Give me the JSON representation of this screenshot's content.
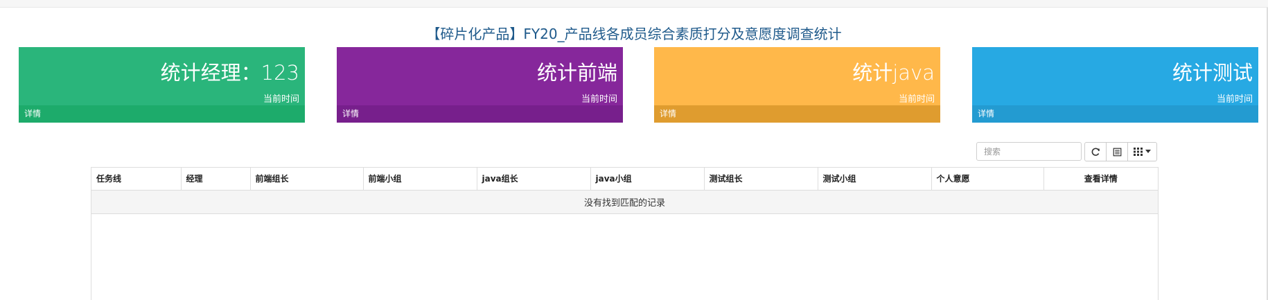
{
  "page": {
    "title": "【碎片化产品】FY20_产品线各成员综合素质打分及意愿度调查统计"
  },
  "cards": [
    {
      "value": "统计经理：123",
      "time": "当前时间",
      "footer": "详情",
      "color": "#2ab57b",
      "footer_color": "#1dab6b"
    },
    {
      "value": "统计前端",
      "time": "当前时间",
      "footer": "详情",
      "color": "#86279b",
      "footer_color": "#771f8c"
    },
    {
      "value": "统计java",
      "time": "当前时间",
      "footer": "详情",
      "color": "#ffb84a",
      "footer_color": "#df9c2f"
    },
    {
      "value": "统计测试",
      "time": "当前时间",
      "footer": "详情",
      "color": "#27a9e3",
      "footer_color": "#239bd1"
    }
  ],
  "toolbar": {
    "search_placeholder": "搜索",
    "refresh_icon": "refresh-icon",
    "toggle_icon": "list-toggle-icon",
    "columns_icon": "columns-grid-icon"
  },
  "table": {
    "columns": [
      "任务线",
      "经理",
      "前端组长",
      "前端小组",
      "java组长",
      "java小组",
      "测试组长",
      "测试小组",
      "个人意愿",
      "查看详情"
    ],
    "empty_message": "没有找到匹配的记录"
  }
}
